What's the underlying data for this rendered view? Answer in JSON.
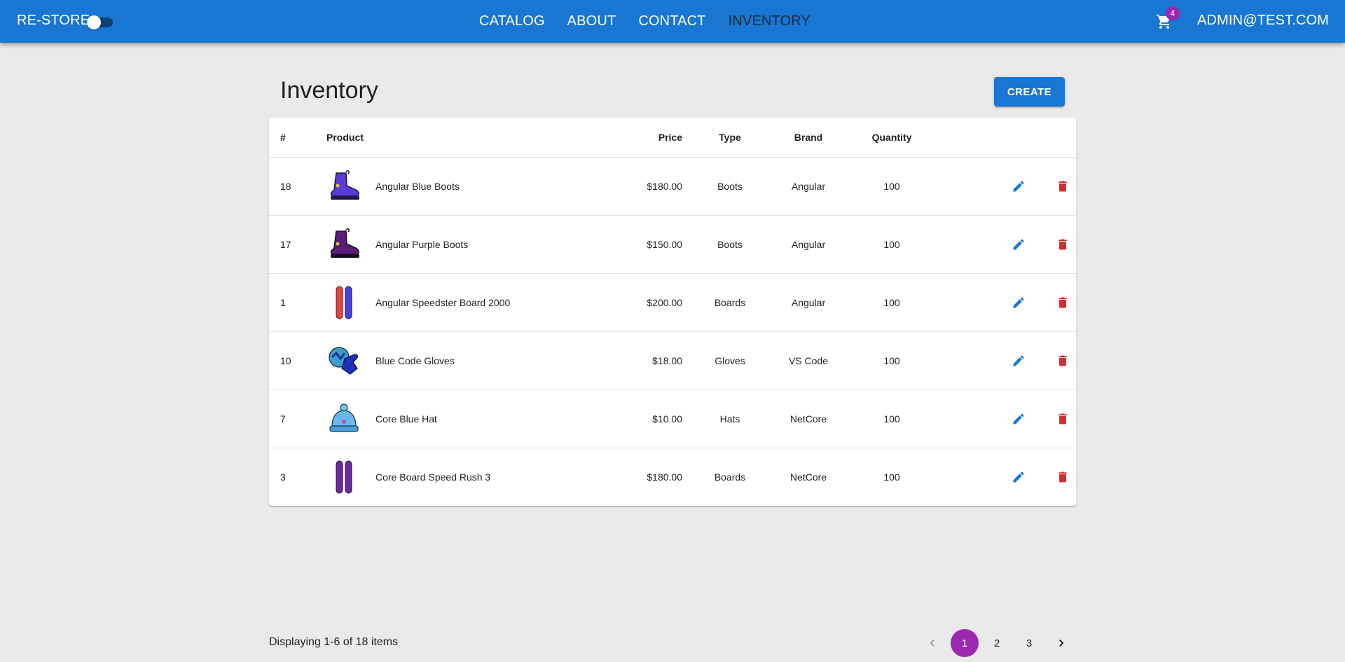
{
  "appbar": {
    "brand": "RE-STORE",
    "dark_mode_toggle": "off",
    "nav": [
      {
        "label": "CATALOG",
        "active": false
      },
      {
        "label": "ABOUT",
        "active": false
      },
      {
        "label": "CONTACT",
        "active": false
      },
      {
        "label": "INVENTORY",
        "active": true
      }
    ],
    "cart_icon": "shopping-cart-icon",
    "cart_count": "4",
    "user": "ADMIN@TEST.COM"
  },
  "page": {
    "title": "Inventory",
    "create_label": "CREATE"
  },
  "table": {
    "headers": {
      "id": "#",
      "product": "Product",
      "price": "Price",
      "type": "Type",
      "brand": "Brand",
      "quantity": "Quantity"
    },
    "rows": [
      {
        "id": "18",
        "name": "Angular Blue Boots",
        "price": "$180.00",
        "type": "Boots",
        "brand": "Angular",
        "quantity": "100",
        "image": "blue-boot"
      },
      {
        "id": "17",
        "name": "Angular Purple Boots",
        "price": "$150.00",
        "type": "Boots",
        "brand": "Angular",
        "quantity": "100",
        "image": "purple-boot"
      },
      {
        "id": "1",
        "name": "Angular Speedster Board 2000",
        "price": "$200.00",
        "type": "Boards",
        "brand": "Angular",
        "quantity": "100",
        "image": "red-blue-board"
      },
      {
        "id": "10",
        "name": "Blue Code Gloves",
        "price": "$18.00",
        "type": "Gloves",
        "brand": "VS Code",
        "quantity": "100",
        "image": "blue-gloves"
      },
      {
        "id": "7",
        "name": "Core Blue Hat",
        "price": "$10.00",
        "type": "Hats",
        "brand": "NetCore",
        "quantity": "100",
        "image": "blue-hat"
      },
      {
        "id": "3",
        "name": "Core Board Speed Rush 3",
        "price": "$180.00",
        "type": "Boards",
        "brand": "NetCore",
        "quantity": "100",
        "image": "purple-board"
      }
    ],
    "edit_icon": "pencil-icon",
    "delete_icon": "trash-icon"
  },
  "footer": {
    "displaying": "Displaying 1-6 of 18 items",
    "pages": [
      "1",
      "2",
      "3"
    ],
    "current_page": "1"
  },
  "colors": {
    "primary": "#1976d2",
    "secondary": "#9c27b0",
    "error": "#d32f2f",
    "background": "#eaeaea"
  }
}
